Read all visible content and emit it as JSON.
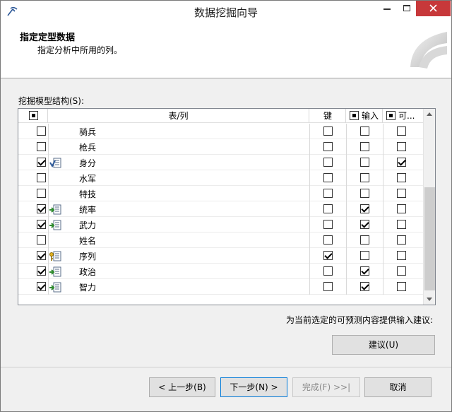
{
  "window": {
    "title": "数据挖掘向导"
  },
  "header": {
    "title": "指定定型数据",
    "subtitle": "指定分析中所用的列。"
  },
  "grid": {
    "label": "挖掘模型结构(S):",
    "columns": {
      "table_col": "表/列",
      "key": "键",
      "input": "输入",
      "predict": "可..."
    },
    "header_checkbox_state": "partial",
    "input_header_checkbox_state": "partial",
    "predict_header_checkbox_state": "partial",
    "rows": [
      {
        "include": false,
        "icon": "",
        "name": "骑兵",
        "key": false,
        "input": false,
        "predict": false
      },
      {
        "include": false,
        "icon": "",
        "name": "枪兵",
        "key": false,
        "input": false,
        "predict": false
      },
      {
        "include": true,
        "icon": "predict-column-icon",
        "name": "身分",
        "key": false,
        "input": false,
        "predict": true
      },
      {
        "include": false,
        "icon": "",
        "name": "水军",
        "key": false,
        "input": false,
        "predict": false
      },
      {
        "include": false,
        "icon": "",
        "name": "特技",
        "key": false,
        "input": false,
        "predict": false
      },
      {
        "include": true,
        "icon": "input-column-icon",
        "name": "统率",
        "key": false,
        "input": true,
        "predict": false
      },
      {
        "include": true,
        "icon": "input-column-icon",
        "name": "武力",
        "key": false,
        "input": true,
        "predict": false
      },
      {
        "include": false,
        "icon": "",
        "name": "姓名",
        "key": false,
        "input": false,
        "predict": false
      },
      {
        "include": true,
        "icon": "key-column-icon",
        "name": "序列",
        "key": true,
        "input": false,
        "predict": false
      },
      {
        "include": true,
        "icon": "input-column-icon",
        "name": "政治",
        "key": false,
        "input": true,
        "predict": false
      },
      {
        "include": true,
        "icon": "input-column-icon",
        "name": "智力",
        "key": false,
        "input": true,
        "predict": false
      }
    ]
  },
  "suggest": {
    "text": "为当前选定的可预测内容提供输入建议:",
    "button": "建议(U)"
  },
  "footer": {
    "back": "< 上一步(B)",
    "next": "下一步(N) >",
    "finish": "完成(F) >>|",
    "cancel": "取消"
  },
  "colors": {
    "close_button": "#c7383a",
    "default_button_border": "#0078d7",
    "selection_accent": "#0078d7"
  }
}
